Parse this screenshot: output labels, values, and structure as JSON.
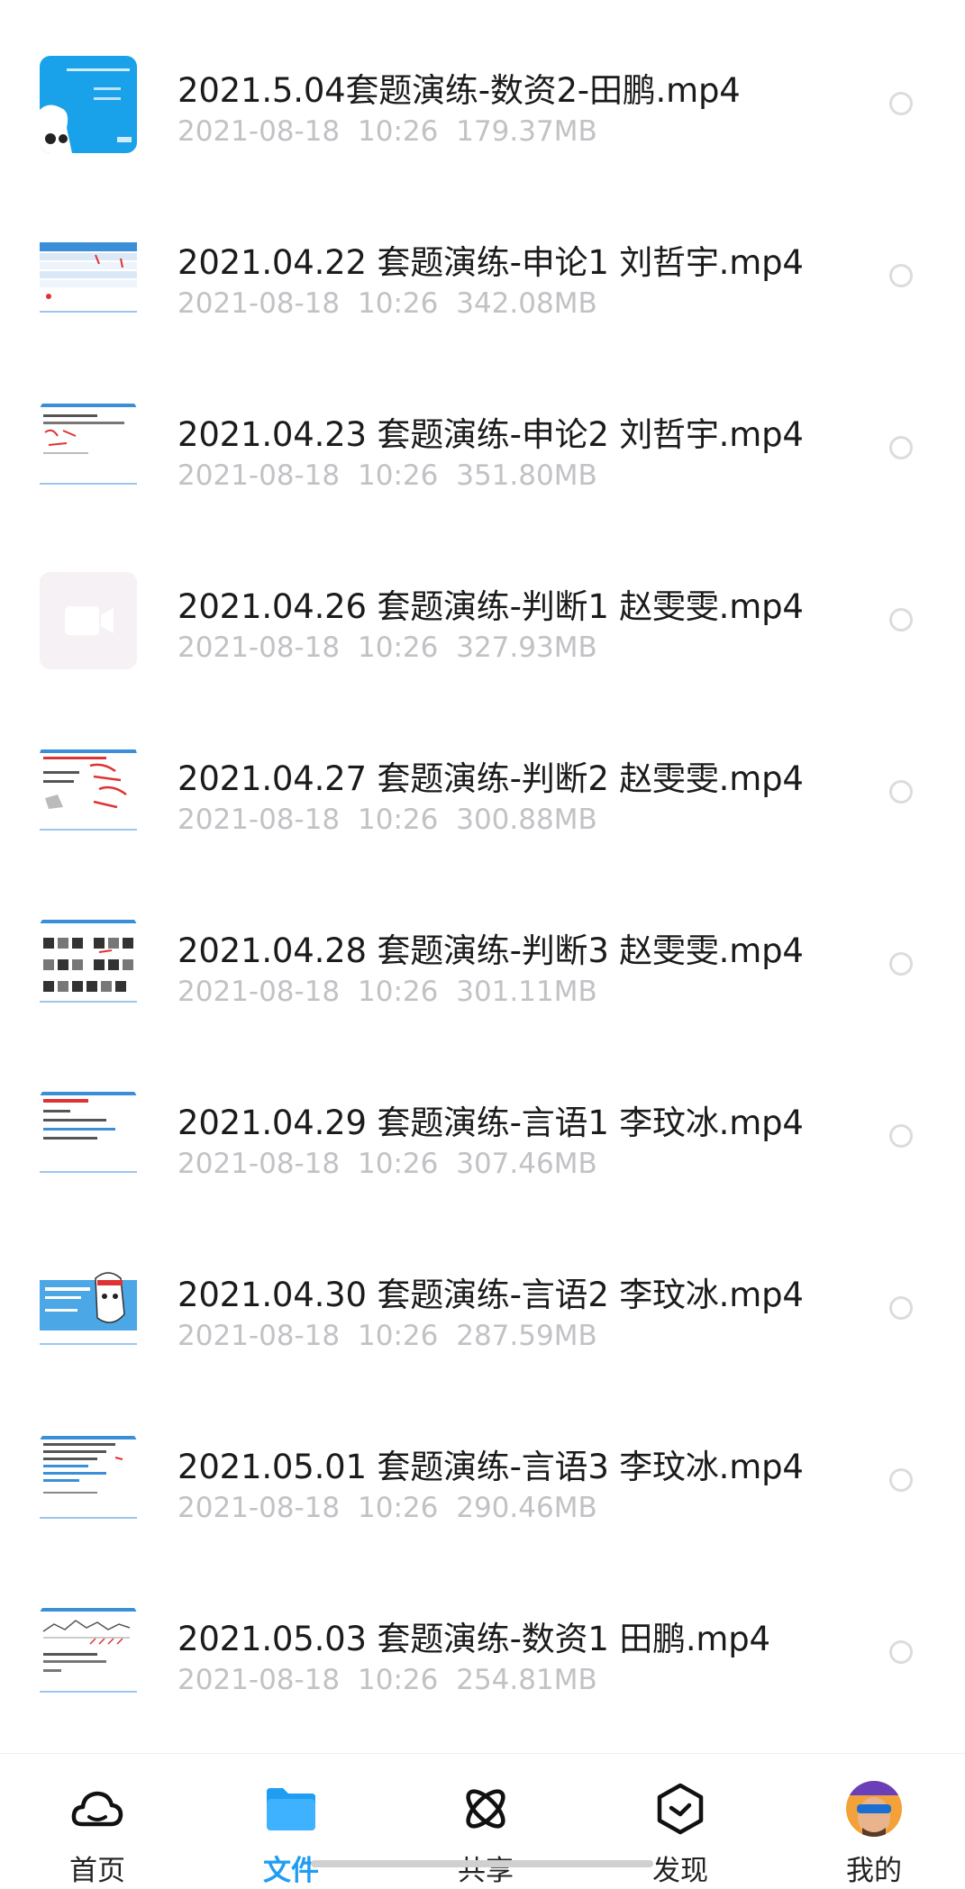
{
  "files": [
    {
      "name": "2021.5.04套题演练-数资2-田鹏.mp4",
      "date": "2021-08-18",
      "time": "10:26",
      "size": "179.37MB",
      "thumb": "mascot-blue"
    },
    {
      "name": "2021.04.22 套题演练-申论1 刘哲宇.mp4",
      "date": "2021-08-18",
      "time": "10:26",
      "size": "342.08MB",
      "thumb": "table-slide"
    },
    {
      "name": "2021.04.23 套题演练-申论2 刘哲宇.mp4",
      "date": "2021-08-18",
      "time": "10:26",
      "size": "351.80MB",
      "thumb": "notes-slide"
    },
    {
      "name": "2021.04.26 套题演练-判断1 赵雯雯.mp4",
      "date": "2021-08-18",
      "time": "10:26",
      "size": "327.93MB",
      "thumb": "video-placeholder"
    },
    {
      "name": "2021.04.27 套题演练-判断2 赵雯雯.mp4",
      "date": "2021-08-18",
      "time": "10:26",
      "size": "300.88MB",
      "thumb": "handwriting-slide"
    },
    {
      "name": "2021.04.28 套题演练-判断3 赵雯雯.mp4",
      "date": "2021-08-18",
      "time": "10:26",
      "size": "301.11MB",
      "thumb": "grid-slide"
    },
    {
      "name": "2021.04.29 套题演练-言语1 李玟冰.mp4",
      "date": "2021-08-18",
      "time": "10:26",
      "size": "307.46MB",
      "thumb": "text-slide"
    },
    {
      "name": "2021.04.30 套题演练-言语2 李玟冰.mp4",
      "date": "2021-08-18",
      "time": "10:26",
      "size": "287.59MB",
      "thumb": "mascot-slide"
    },
    {
      "name": "2021.05.01 套题演练-言语3 李玟冰.mp4",
      "date": "2021-08-18",
      "time": "10:26",
      "size": "290.46MB",
      "thumb": "text-slide-2"
    },
    {
      "name": "2021.05.03 套题演练-数资1 田鹏.mp4",
      "date": "2021-08-18",
      "time": "10:26",
      "size": "254.81MB",
      "thumb": "chart-slide"
    }
  ],
  "tabs": [
    {
      "label": "首页",
      "icon": "cloud-icon",
      "active": false
    },
    {
      "label": "文件",
      "icon": "folder-icon",
      "active": true
    },
    {
      "label": "共享",
      "icon": "share-atom-icon",
      "active": false
    },
    {
      "label": "发现",
      "icon": "discover-hexagon-icon",
      "active": false
    },
    {
      "label": "我的",
      "icon": "avatar",
      "active": false
    }
  ],
  "colors": {
    "accent": "#1f9df2",
    "title_text": "#1b1b1b",
    "meta_text": "#c2c2c6"
  }
}
